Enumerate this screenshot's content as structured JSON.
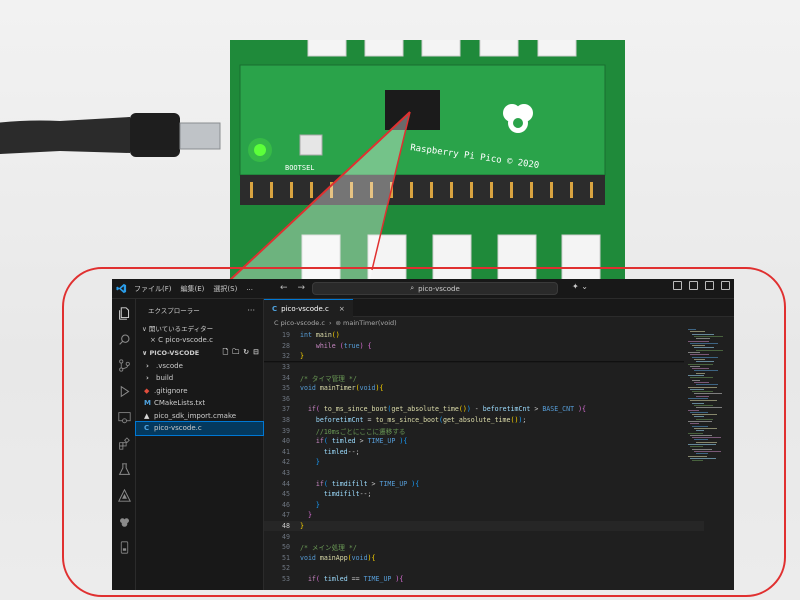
{
  "window": {
    "menu": [
      "ファイル(F)",
      "編集(E)",
      "選択(S)",
      "..."
    ],
    "search_text": "pico-vscode",
    "copilot_label": "✦ ⌄"
  },
  "explorer": {
    "title": "エクスプローラー",
    "more": "···",
    "open_editors": "∨ 開いているエディター",
    "open_editor_item": "× C  pico-vscode.c",
    "folder": "∨ PICO-VSCODE",
    "items": [
      {
        "label": ".vscode",
        "type": "folder",
        "icon": "›",
        "icon_color": "#cccccc"
      },
      {
        "label": "build",
        "type": "folder",
        "icon": "›",
        "icon_color": "#cccccc"
      },
      {
        "label": ".gitignore",
        "type": "file",
        "icon": "◆",
        "icon_color": "#e24e3d"
      },
      {
        "label": "CMakeLists.txt",
        "type": "file",
        "icon": "M",
        "icon_color": "#4fa3e0"
      },
      {
        "label": "pico_sdk_import.cmake",
        "type": "file",
        "icon": "▲",
        "icon_color": "#d7d7d7"
      },
      {
        "label": "pico-vscode.c",
        "type": "file",
        "icon": "C",
        "icon_color": "#4fa3e0",
        "active": true
      }
    ]
  },
  "editor": {
    "tab_icon": "C",
    "tab_label": "pico-vscode.c",
    "tab_close": "×",
    "breadcrumb_file": "C pico-vscode.c",
    "breadcrumb_sep": "›",
    "breadcrumb_symbol": "⊚ mainTimer(void)",
    "lines": [
      {
        "n": "19",
        "html": "<span class='kw'>int</span> <span class='fn'>main</span><span class='br1'>()</span>"
      },
      {
        "n": "28",
        "html": "    <span class='kw' style='color:#c586c0'>while</span> <span class='br2'>(</span><span class='kw'>true</span><span class='br2'>)</span> <span class='br2'>{</span>"
      },
      {
        "n": "32",
        "html": "<span class='br1'>}</span>"
      },
      {
        "n": "33",
        "html": ""
      },
      {
        "n": "34",
        "html": "<span class='cm'>/* タイマ管理 */</span>"
      },
      {
        "n": "35",
        "html": "<span class='kw'>void</span> <span class='fn'>mainTimer</span><span class='br1'>(</span><span class='kw'>void</span><span class='br1'>){</span>"
      },
      {
        "n": "36",
        "html": ""
      },
      {
        "n": "37",
        "html": "  <span class='kw' style='color:#c586c0'>if</span><span class='br2'>(</span> <span class='fn'>to_ms_since_boot</span><span class='br3'>(</span><span class='fn'>get_absolute_time</span><span class='br1'>()</span><span class='br3'>)</span> - <span class='var'>beforetimCnt</span> &gt; <span class='mac'>BASE_CNT</span> <span class='br2'>){</span>"
      },
      {
        "n": "38",
        "html": "    <span class='var'>beforetimCnt</span> = <span class='fn'>to_ms_since_boot</span><span class='br3'>(</span><span class='fn'>get_absolute_time</span><span class='br1'>()</span><span class='br3'>)</span>;"
      },
      {
        "n": "39",
        "html": "    <span class='cm'>//10msごとにここに遷移する</span>"
      },
      {
        "n": "40",
        "html": "    <span class='kw' style='color:#c586c0'>if</span><span class='br3'>(</span> <span class='var'>timled</span> &gt; <span class='mac'>TIME_UP</span> <span class='br3'>){</span>"
      },
      {
        "n": "41",
        "html": "      <span class='var'>timled</span>--;"
      },
      {
        "n": "42",
        "html": "    <span class='br3'>}</span>"
      },
      {
        "n": "43",
        "html": ""
      },
      {
        "n": "44",
        "html": "    <span class='kw' style='color:#c586c0'>if</span><span class='br3'>(</span> <span class='var'>timdifilt</span> &gt; <span class='mac'>TIME_UP</span> <span class='br3'>){</span>"
      },
      {
        "n": "45",
        "html": "      <span class='var'>timdifilt</span>--;"
      },
      {
        "n": "46",
        "html": "    <span class='br3'>}</span>"
      },
      {
        "n": "47",
        "html": "  <span class='br2'>}</span>"
      },
      {
        "n": "48",
        "html": "<span class='br1'>}</span>",
        "current": true
      },
      {
        "n": "49",
        "html": ""
      },
      {
        "n": "50",
        "html": "<span class='cm'>/* メイン処理 */</span>"
      },
      {
        "n": "51",
        "html": "<span class='kw'>void</span> <span class='fn'>mainApp</span><span class='br1'>(</span><span class='kw'>void</span><span class='br1'>){</span>"
      },
      {
        "n": "52",
        "html": ""
      },
      {
        "n": "53",
        "html": "  <span class='kw' style='color:#c586c0'>if</span><span class='br2'>(</span> <span class='var'>timled</span> == <span class='mac'>TIME_UP</span> <span class='br2'>){</span>"
      }
    ]
  },
  "photo": {
    "board_silkscreen": "Raspberry Pi Pico © 2020",
    "bootsel_label": "BOOTSEL",
    "led_color": "#5dff3a",
    "board_color": "#1f8a3a",
    "callout_color": "#e03030"
  }
}
